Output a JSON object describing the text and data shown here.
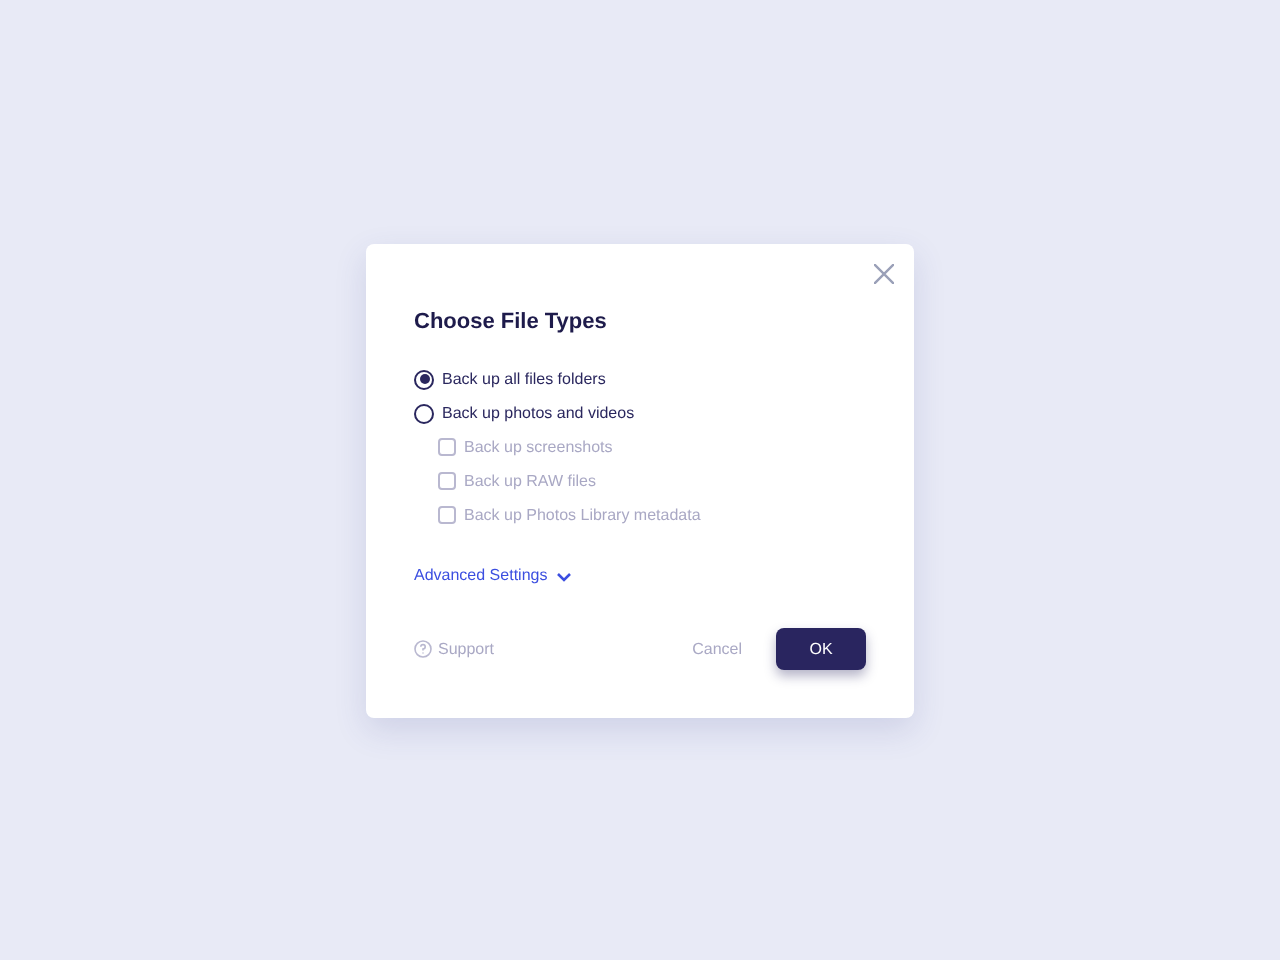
{
  "dialog": {
    "title": "Choose File Types",
    "options": [
      {
        "kind": "radio",
        "label": "Back up all files folders",
        "selected": true,
        "disabled": false
      },
      {
        "kind": "radio",
        "label": "Back up photos and videos",
        "selected": false,
        "disabled": false
      },
      {
        "kind": "checkbox",
        "label": "Back up screenshots",
        "checked": false,
        "disabled": true
      },
      {
        "kind": "checkbox",
        "label": "Back up RAW files",
        "checked": false,
        "disabled": true
      },
      {
        "kind": "checkbox",
        "label": "Back up Photos Library metadata",
        "checked": false,
        "disabled": true
      }
    ],
    "advanced": {
      "label": "Advanced Settings",
      "expanded": false
    },
    "support": "Support",
    "cancel": "Cancel",
    "ok": "OK"
  }
}
